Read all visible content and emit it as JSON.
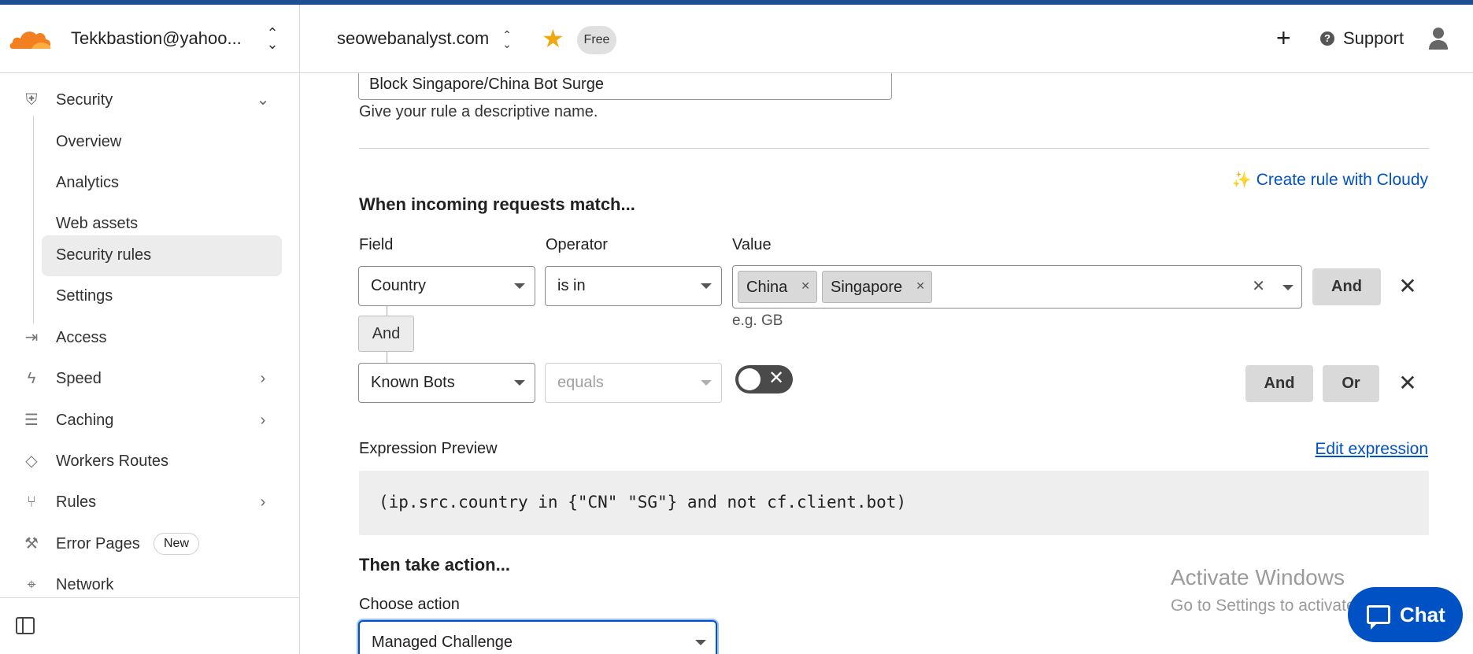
{
  "header": {
    "account": "Tekkbastion@yahoo...",
    "domain": "seowebanalyst.com",
    "plan": "Free",
    "support": "Support"
  },
  "sidebar": {
    "items": [
      {
        "label": "Security",
        "icon": "shield-icon"
      },
      {
        "label": "Access",
        "icon": "access-icon"
      },
      {
        "label": "Speed",
        "icon": "lightning-icon"
      },
      {
        "label": "Caching",
        "icon": "database-icon"
      },
      {
        "label": "Workers Routes",
        "icon": "workers-icon"
      },
      {
        "label": "Rules",
        "icon": "rules-icon"
      },
      {
        "label": "Error Pages",
        "icon": "wrench-icon",
        "badge": "New"
      },
      {
        "label": "Network",
        "icon": "location-pin-icon"
      }
    ],
    "security_sub": [
      "Overview",
      "Analytics",
      "Web assets",
      "Security rules",
      "Settings"
    ],
    "active_sub": "Security rules"
  },
  "rule": {
    "name_value": "Block Singapore/China Bot Surge",
    "name_help": "Give your rule a descriptive name.",
    "cloudy_link": "Create rule with Cloudy",
    "match_title": "When incoming requests match...",
    "labels": {
      "field": "Field",
      "operator": "Operator",
      "value": "Value"
    },
    "row1": {
      "field": "Country",
      "operator": "is in",
      "chips": [
        "China",
        "Singapore"
      ],
      "hint": "e.g. GB",
      "and": "And"
    },
    "connector": "And",
    "row2": {
      "field": "Known Bots",
      "operator": "equals",
      "toggle_on": false,
      "and": "And",
      "or": "Or"
    },
    "preview_label": "Expression Preview",
    "edit_link": "Edit expression",
    "expression": "(ip.src.country in {\"CN\" \"SG\"} and not cf.client.bot)",
    "action_title": "Then take action...",
    "action_label": "Choose action",
    "action_value": "Managed Challenge"
  },
  "overlay": {
    "watermark_title": "Activate Windows",
    "watermark_sub": "Go to Settings to activate Windows.",
    "chat": "Chat"
  },
  "colors": {
    "accent": "#0051c3",
    "brand_orange": "#f38020",
    "star": "#f0a810"
  }
}
